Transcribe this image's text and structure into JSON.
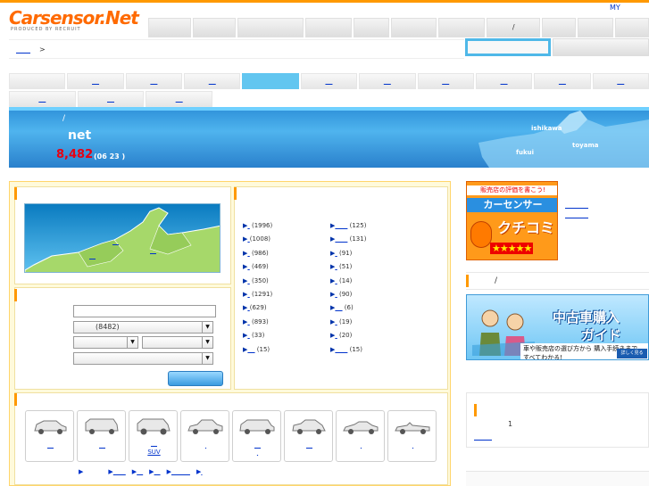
{
  "header": {
    "logo_text": "Carsensor.Net",
    "logo_tagline": "PRODUCED BY RECRUIT",
    "my_link": "MY",
    "global_nav_slash": "/"
  },
  "breadcrumb": {
    "separator": ">"
  },
  "banner": {
    "slash": "/",
    "title": "net",
    "count": "8,482",
    "date": "(06 23 )",
    "pref_ishikawa": "ishikawa",
    "pref_toyama": "toyama",
    "pref_fukui": "fukui"
  },
  "search": {
    "count_option": "(8482)"
  },
  "area_counts_left": [
    "(1996)",
    "(1008)",
    "(986)",
    "(469)",
    "(350)",
    "(1291)",
    "(629)",
    "(893)",
    "(33)",
    "(15)"
  ],
  "area_counts_right": [
    "(125)",
    "(131)",
    "(91)",
    "(51)",
    "(14)",
    "(90)",
    "(6)",
    "(19)",
    "(20)",
    "(15)"
  ],
  "body_types": {
    "suv_label": "SUV"
  },
  "sidebar": {
    "guide_slash": "/",
    "ad_kuchikomi_top": "販売店の評価を書こう!",
    "ad_kuchikomi_brand": "カーセンサー",
    "ad_kuchikomi_title": "クチコミ",
    "ad_kuchikomi_stars": "★★★★★",
    "ad_guide_title1": "中古車購入",
    "ad_guide_title2": "ガイド",
    "ad_guide_sub": "車や販売店の選び方から 購入手続きまで、すべてわかる!",
    "ad_guide_button": "詳しく見る",
    "rank_number": "1"
  },
  "colors": {
    "accent": "#ff9900",
    "link": "#0033cc",
    "banner": "#3ba3e6",
    "count": "#e60012"
  }
}
